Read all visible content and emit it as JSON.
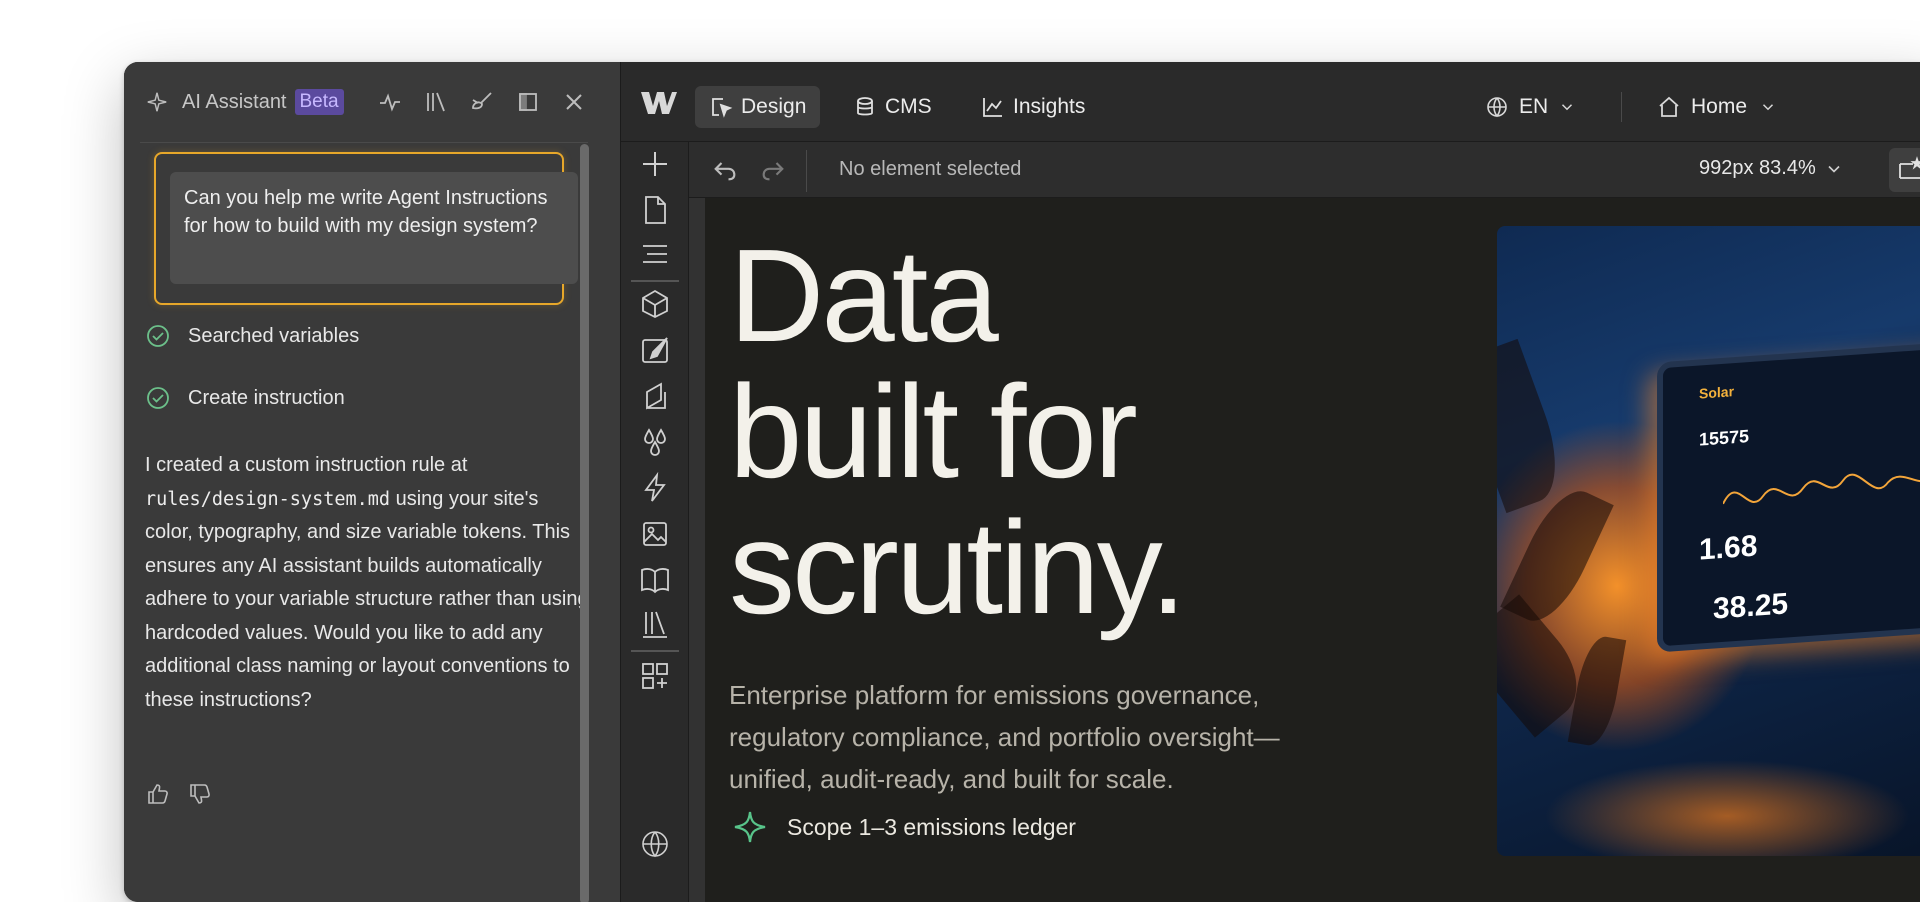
{
  "ai_panel": {
    "title": "AI Assistant",
    "badge": "Beta",
    "prompt": "Can you help me write Agent Instructions for how to build with my design system?",
    "steps": [
      {
        "label": "Searched variables",
        "status": "done"
      },
      {
        "label": "Create instruction",
        "status": "done"
      }
    ],
    "reply": {
      "before_code": "I created a custom instruction rule at",
      "code": "rules/design-system.md",
      "after_code": "using your site's color, typography, and size variable tokens. This ensures any AI assistant builds automatically adhere to your variable structure rather than using hardcoded values. Would you like to add any additional class naming or layout conventions to these instructions?"
    },
    "accent_color": "#e7a72a",
    "check_color": "#6cc08a"
  },
  "topbar": {
    "tabs": [
      {
        "label": "Design",
        "icon": "cursor-icon",
        "active": true
      },
      {
        "label": "CMS",
        "icon": "database-icon",
        "active": false
      },
      {
        "label": "Insights",
        "icon": "chart-icon",
        "active": false
      }
    ],
    "locale": "EN",
    "page": "Home"
  },
  "subbar": {
    "status": "No element selected",
    "size": "992px 83.4%"
  },
  "canvas": {
    "hero_title": [
      "Data",
      "built for",
      "scrutiny."
    ],
    "hero_sub": "Enterprise platform for emissions governance, regulatory compliance, and portfolio oversight—unified, audit-ready, and built for scale.",
    "feature": "Scope 1–3 emissions ledger",
    "monitor": {
      "brand": "Solar",
      "readouts": [
        "15575",
        "1.68",
        "38.25"
      ]
    }
  }
}
